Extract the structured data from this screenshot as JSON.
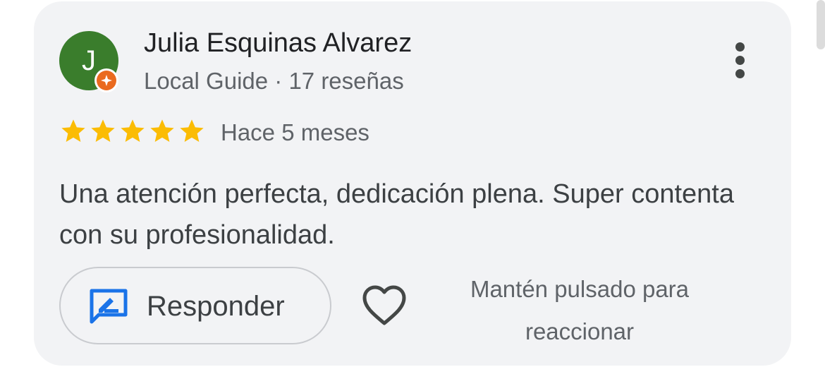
{
  "review": {
    "avatar_initial": "J",
    "author_name": "Julia Esquinas Alvarez",
    "author_subline": "Local Guide · 17 reseñas",
    "rating": 5,
    "rating_max": 5,
    "date": "Hace 5 meses",
    "text": "Una atención perfecta, dedicación plena. Super contenta con su profesionalidad."
  },
  "actions": {
    "reply_label": "Responder",
    "reply_icon": "reply-edit-icon",
    "like_icon": "heart-outline-icon",
    "hold_hint": "Mantén pulsado para reaccionar",
    "more_icon": "more-vertical-icon"
  },
  "colors": {
    "avatar_bg": "#3a7d2c",
    "guide_badge": "#ea6a1f",
    "star": "#fbbc04",
    "reply_icon": "#1a73e8",
    "card_bg": "#f2f3f5"
  }
}
